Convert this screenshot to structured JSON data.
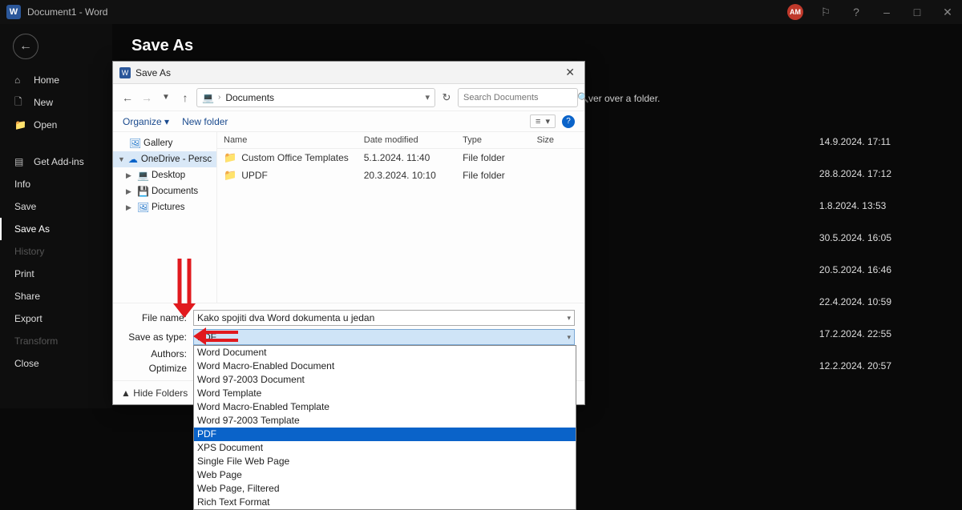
{
  "titlebar": {
    "app_title": "Document1  -  Word",
    "avatar": "AM"
  },
  "sidebar": {
    "home": "Home",
    "new": "New",
    "open": "Open",
    "get_addins": "Get Add-ins",
    "info": "Info",
    "save": "Save",
    "save_as": "Save As",
    "history": "History",
    "print": "Print",
    "share": "Share",
    "export": "Export",
    "transform": "Transform",
    "close": "Close"
  },
  "page": {
    "title": "Save As",
    "hint_tail": "ver over a folder."
  },
  "dates": [
    "14.9.2024. 17:11",
    "28.8.2024. 17:12",
    "1.8.2024. 13:53",
    "30.5.2024. 16:05",
    "20.5.2024. 16:46",
    "22.4.2024. 10:59",
    "17.2.2024. 22:55",
    "12.2.2024. 20:57"
  ],
  "dialog": {
    "title": "Save As",
    "path_label": "Documents",
    "search_placeholder": "Search Documents",
    "organize": "Organize",
    "new_folder": "New folder",
    "tree": {
      "gallery": "Gallery",
      "onedrive": "OneDrive - Persc",
      "desktop": "Desktop",
      "documents": "Documents",
      "pictures": "Pictures"
    },
    "columns": {
      "name": "Name",
      "date": "Date modified",
      "type": "Type",
      "size": "Size"
    },
    "rows": [
      {
        "name": "Custom Office Templates",
        "date": "5.1.2024. 11:40",
        "type": "File folder"
      },
      {
        "name": "UPDF",
        "date": "20.3.2024. 10:10",
        "type": "File folder"
      }
    ],
    "form": {
      "filename_label": "File name:",
      "filename_value": "Kako spojiti dva Word dokumenta u jedan",
      "saveas_label": "Save as type:",
      "saveas_value": "PDF",
      "authors_label": "Authors:",
      "optimize_label": "Optimize"
    },
    "dropdown": [
      "Word Document",
      "Word Macro-Enabled Document",
      "Word 97-2003 Document",
      "Word Template",
      "Word Macro-Enabled Template",
      "Word 97-2003 Template",
      "PDF",
      "XPS Document",
      "Single File Web Page",
      "Web Page",
      "Web Page, Filtered",
      "Rich Text Format"
    ],
    "dropdown_selected": "PDF",
    "hide_folders": "Hide Folders"
  }
}
